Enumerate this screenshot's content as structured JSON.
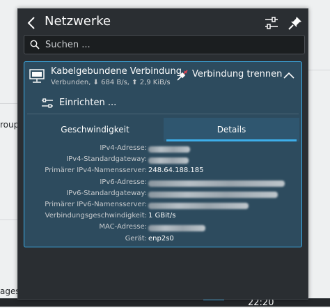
{
  "background": {
    "left_fragment_1": "roup",
    "left_fragment_2": "ages",
    "clock": "22:20"
  },
  "header": {
    "title": "Netzwerke"
  },
  "search": {
    "placeholder": "Suchen ..."
  },
  "connection": {
    "name": "Kabelgebundene Verbindung",
    "status": "Verbunden, ⬇ 684 B/s, ⬆ 2,9 KiB/s",
    "disconnect_label": "Verbindung trennen",
    "setup_label": "Einrichten ..."
  },
  "tabs": [
    {
      "label": "Geschwindigkeit",
      "active": false
    },
    {
      "label": "Details",
      "active": true
    }
  ],
  "details": [
    {
      "key": "IPv4-Adresse:",
      "value": "",
      "redacted": true
    },
    {
      "key": "IPv4-Standardgateway:",
      "value": "",
      "redacted": true
    },
    {
      "key": "Primärer IPv4-Namensserver:",
      "value": "248.64.188.185",
      "redacted": false
    },
    {
      "key": "IPv6-Adresse:",
      "value": "",
      "redacted": true
    },
    {
      "key": "IPv6-Standardgateway:",
      "value": "",
      "redacted": true
    },
    {
      "key": "Primärer IPv6-Namensserver:",
      "value": "",
      "redacted": true
    },
    {
      "key": "Verbindungsgeschwindigkeit:",
      "value": "1 GBit/s",
      "redacted": false
    },
    {
      "key": "MAC-Adresse:",
      "value": "",
      "redacted": true
    },
    {
      "key": "Gerät:",
      "value": "enp2s0",
      "redacted": false
    }
  ],
  "colors": {
    "accent": "#3daee9",
    "popup_bg": "#2a2e32",
    "card_bg": "#2d4b5e"
  }
}
